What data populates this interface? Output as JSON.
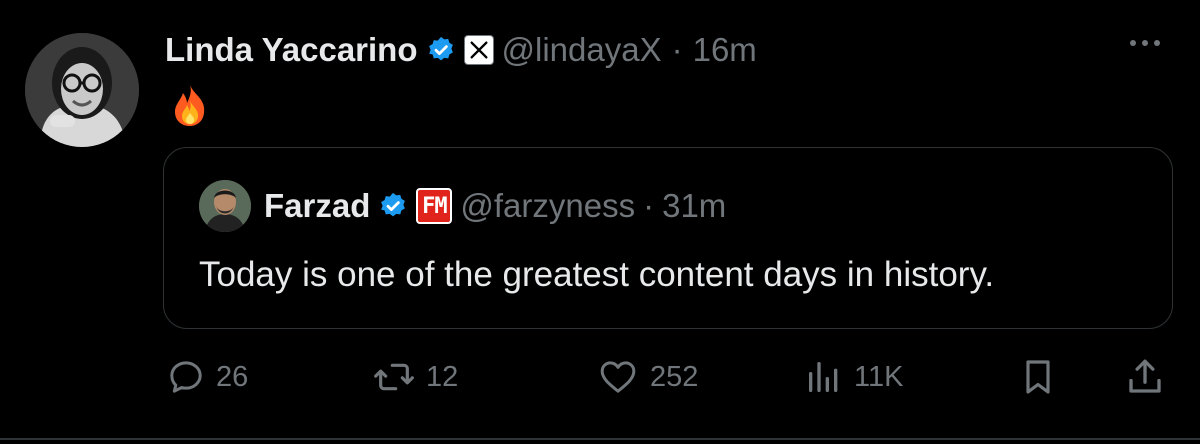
{
  "tweet": {
    "author_name": "Linda Yaccarino",
    "author_handle": "@lindayaX",
    "separator": "·",
    "time": "16m",
    "emoji": "🔥",
    "xbadge_text": "𝕏"
  },
  "quoted": {
    "author_name": "Farzad",
    "author_handle": "@farzyness",
    "separator": "·",
    "time": "31m",
    "badge_text": "FM",
    "text": "Today is one of the greatest content days in history."
  },
  "actions": {
    "replies": "26",
    "reposts": "12",
    "likes": "252",
    "views": "11K"
  },
  "colors": {
    "background": "#000000",
    "text": "#e7e9ea",
    "muted": "#71767b",
    "verified": "#1d9bf0",
    "border": "#2f3336"
  }
}
